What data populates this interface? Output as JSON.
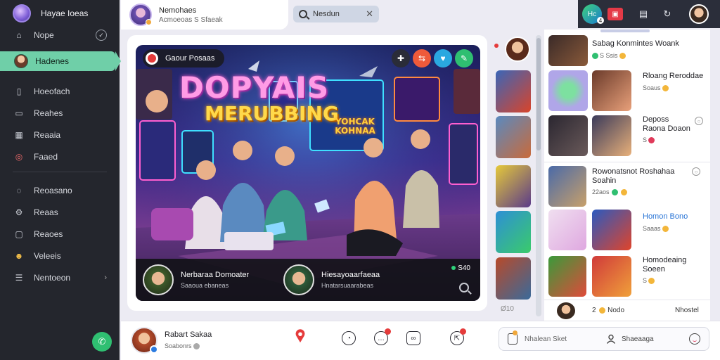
{
  "app": {
    "title": "Hayae Ioeas"
  },
  "sidebar": {
    "items": [
      {
        "label": "Nope",
        "icon": "home-icon",
        "badge": "✓"
      },
      {
        "label": "Hadenes",
        "icon": "avatar-icon",
        "active": true
      },
      {
        "label": "Hoeofach",
        "icon": "notebook-icon"
      },
      {
        "label": "Reahes",
        "icon": "monitor-icon"
      },
      {
        "label": "Reaaia",
        "icon": "calendar-icon"
      },
      {
        "label": "Faaed",
        "icon": "instagram-icon"
      },
      {
        "label": "Reoasano",
        "icon": "chat-icon"
      },
      {
        "label": "Reaas",
        "icon": "settings-icon"
      },
      {
        "label": "Reaoes",
        "icon": "clipboard-icon"
      },
      {
        "label": "Veleeis",
        "icon": "emoji-icon"
      },
      {
        "label": "Nentoeon",
        "icon": "menu-icon",
        "chevron": "›"
      }
    ],
    "fab_icon": "phone-icon"
  },
  "header": {
    "user_name": "Nemohaes",
    "user_sub": "Acmoeoas S Sfaeak",
    "search_value": "Nesdun",
    "search_close": "✕",
    "notif_label": "Hc",
    "notif_count": "4"
  },
  "hero": {
    "badge_label": "Gaour Posaas",
    "title_line1": "DOPYAIS",
    "title_line2": "MERUBBING",
    "neon_line1": "YOHCAK",
    "neon_line2": "KOHNAA",
    "actions": [
      {
        "icon": "plus-icon",
        "color": "#2a2c38"
      },
      {
        "icon": "share-icon",
        "color": "#ef5a3a"
      },
      {
        "icon": "heart-icon",
        "color": "#2aa8e0"
      },
      {
        "icon": "chat-icon",
        "color": "#2fbf71"
      }
    ],
    "streamers": [
      {
        "name": "Nerbaraa Domoater",
        "meta": "Saaoua ebaneas"
      },
      {
        "name": "Hiesayoaarfaeaa",
        "meta": "Hnatarsuaarabeas"
      }
    ],
    "live_label": "S40"
  },
  "thumbs": {
    "footer": "Ø10",
    "colors": [
      "#d9442a",
      "#3a66b8",
      "#e5c93a",
      "#2e8fd6",
      "#b84a2a"
    ]
  },
  "right_list": {
    "items": [
      {
        "title": "Sabag Konmintes Woank",
        "meta": "S Ssis",
        "thumb": "#3a2a28"
      },
      {
        "title": "Rloang Reroddae",
        "meta": "Soaus",
        "thumb": "#b0a6e8"
      },
      {
        "title": "Deposs Raona Doaon",
        "meta": "S",
        "thumb": "#2a2630"
      },
      {
        "title": "Rowonatsnot Roshahaa Soahin",
        "meta": "22aos",
        "thumb": "#4a6aa8"
      },
      {
        "title": "Homon Bono",
        "meta": "Saaas",
        "thumb": "#dfa8e0",
        "blue": true
      },
      {
        "title": "Homodeaing Soeen",
        "meta": "S",
        "thumb": "#3a9a3a"
      },
      {
        "title": "Nodo",
        "meta": "2",
        "right": "Nhostel"
      }
    ]
  },
  "bottom": {
    "user_name": "Rabart Sakaa",
    "user_sub": "Soabonrs",
    "input_placeholder": "Nhalean Sket",
    "input_second": "Shaeaaga"
  }
}
